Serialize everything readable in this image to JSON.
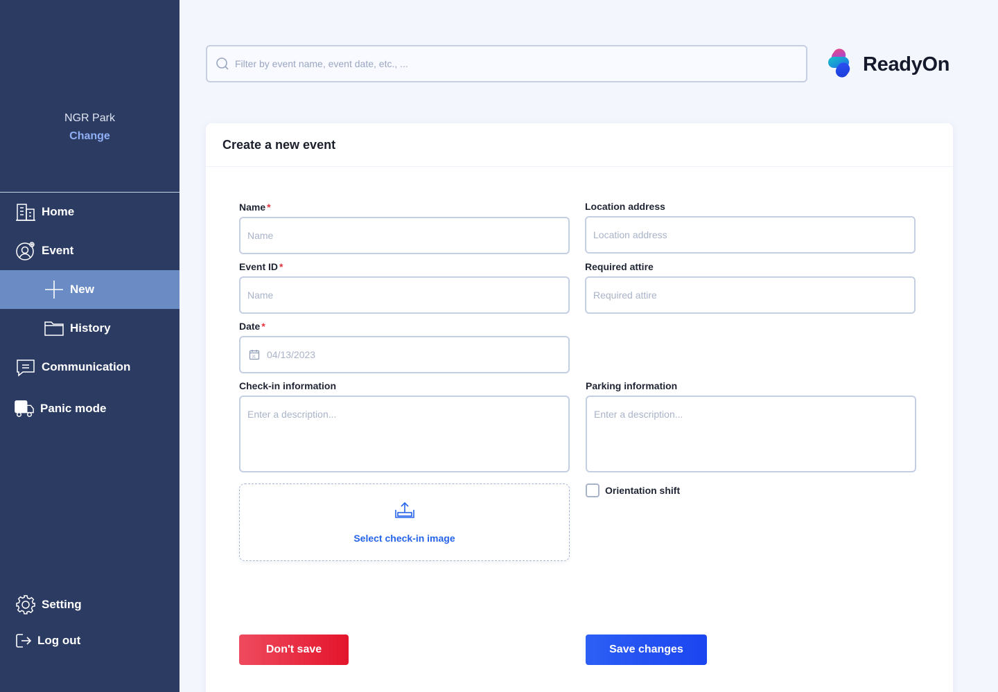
{
  "sidebar": {
    "org_name": "NGR Park",
    "org_change": "Change",
    "items": [
      {
        "label": "Home",
        "icon": "building-icon"
      },
      {
        "label": "Event",
        "icon": "user-gear-icon"
      },
      {
        "label": "New",
        "icon": "plus-icon",
        "active": true
      },
      {
        "label": "History",
        "icon": "folder-icon"
      },
      {
        "label": "Communication",
        "icon": "chat-icon"
      },
      {
        "label": "Panic mode",
        "icon": "truck-icon"
      }
    ],
    "bottom_items": [
      {
        "label": "Setting",
        "icon": "gear-icon"
      },
      {
        "label": "Log out",
        "icon": "logout-icon"
      }
    ],
    "colors": {
      "background": "#2c3b62",
      "active": "#6b8bc4",
      "change_link": "#8fb0f5"
    }
  },
  "search": {
    "placeholder": "Filter by event name, event date, etc., ..."
  },
  "brand": {
    "name": "ReadyOn",
    "icon": "readyon-logo-icon"
  },
  "form": {
    "title": "Create a new event",
    "name": {
      "label": "Name",
      "placeholder": "Name",
      "required": "*"
    },
    "location": {
      "label": "Location address",
      "placeholder": "Location address"
    },
    "event_id": {
      "label": "Event ID",
      "placeholder": "Name",
      "required": "*"
    },
    "attire": {
      "label": "Required attire",
      "placeholder": "Required attire"
    },
    "date": {
      "label": "Date",
      "placeholder": "04/13/2023",
      "required": "*",
      "icon": "calendar-icon"
    },
    "checkin": {
      "label": "Check-in information",
      "placeholder": "Enter a description..."
    },
    "parking": {
      "label": "Parking information",
      "placeholder": "Enter a description..."
    },
    "upload": {
      "label": "Select check-in image",
      "icon": "upload-icon"
    },
    "orientation": {
      "label": "Orientation shift",
      "checked": false
    },
    "dont_save": "Don't save",
    "save": "Save changes"
  },
  "colors": {
    "page_bg": "#f3f6fd",
    "danger": "#e4152c",
    "primary": "#1b45f0",
    "link": "#2563eb"
  }
}
